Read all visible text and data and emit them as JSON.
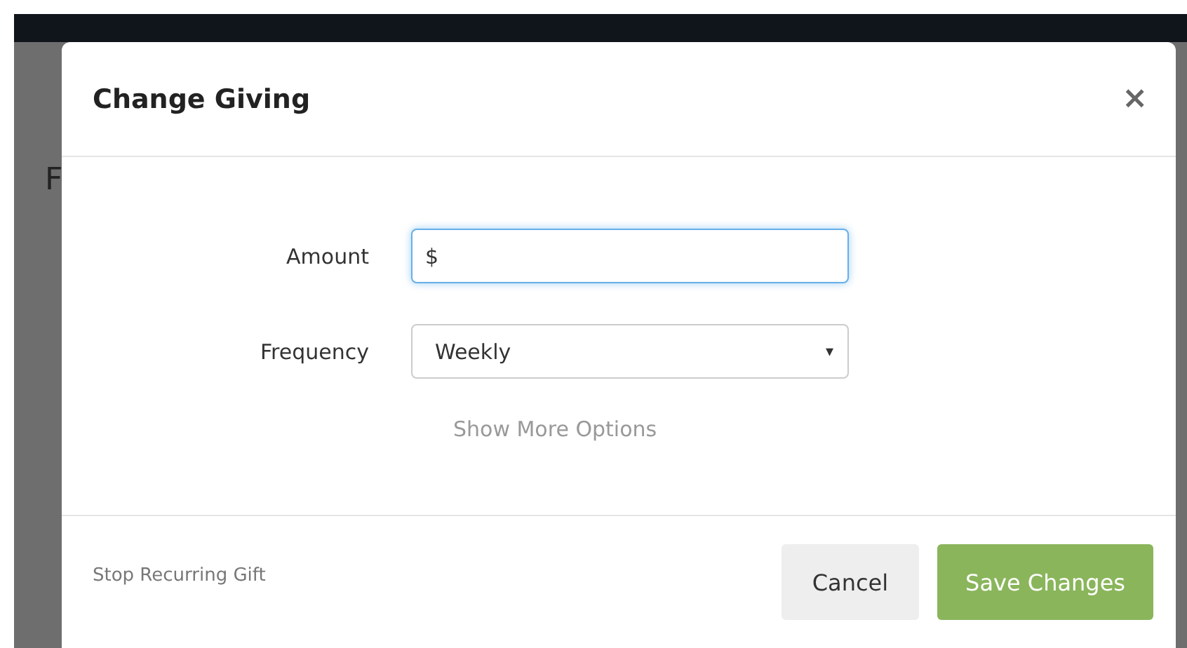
{
  "background_heading": "F",
  "dialog": {
    "title": "Change Giving",
    "close": "×",
    "fields": [
      {
        "kind": "input",
        "label": "Amount",
        "value": "$",
        "focused": true
      },
      {
        "kind": "select",
        "label": "Frequency",
        "value": "Weekly",
        "arrow": "▾",
        "focused": false
      }
    ],
    "more_options": "Show More Options",
    "stop_link": "Stop Recurring Gift",
    "buttons": [
      {
        "label": "Cancel",
        "kind": "secondary"
      },
      {
        "label": "Save Changes",
        "kind": "primary"
      }
    ]
  }
}
